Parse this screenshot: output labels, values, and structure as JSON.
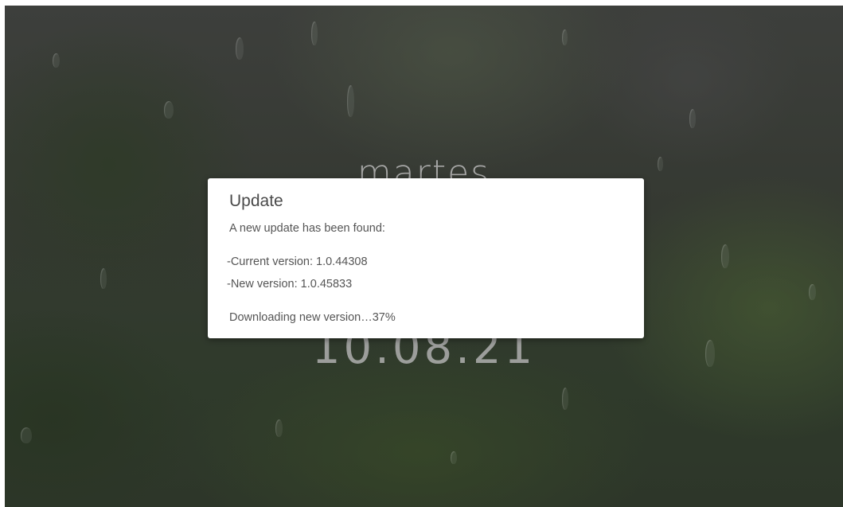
{
  "lockscreen": {
    "day": "martes",
    "date": "10.08.21"
  },
  "update_dialog": {
    "title": "Update",
    "message": "A new update has been found:",
    "current_version": "-Current version: 1.0.44308",
    "new_version": "-New version: 1.0.45833",
    "status": "Downloading new version…37%"
  },
  "download_progress_percent": 37
}
